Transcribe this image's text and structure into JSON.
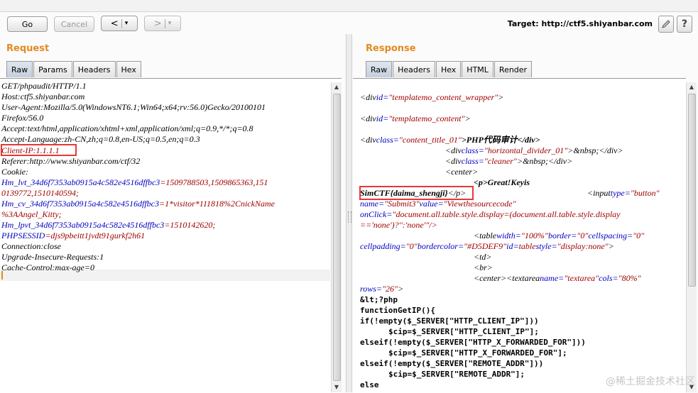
{
  "toolbar": {
    "go_label": "Go",
    "cancel_label": "Cancel",
    "back_label": "<",
    "back_menu": "▾",
    "forward_label": ">",
    "forward_menu": "▾",
    "target_text": "Target: http://ctf5.shiyanbar.com"
  },
  "request": {
    "title": "Request",
    "tabs": [
      "Raw",
      "Params",
      "Headers",
      "Hex"
    ],
    "lines": {
      "l1": "GET/phpaudit/HTTP/1.1",
      "l2": "Host:ctf5.shiyanbar.com",
      "l3": "User-Agent:Mozilla/5.0(WindowsNT6.1;Win64;x64;rv:56.0)Gecko/20100101",
      "l4": "Firefox/56.0",
      "l5": "Accept:text/html,application/xhtml+xml,application/xml;q=0.9,*/*;q=0.8",
      "l6": "Accept-Language:zh-CN,zh;q=0.8,en-US;q=0.5,en;q=0.3",
      "l7_name": "Client-IP",
      "l7_value": ":1.1.1.1",
      "l8": "Referer:http://www.shiyanbar.com/ctf/32",
      "l9": "Cookie:",
      "c1_name": "Hm_lvt_34d6f7353ab0915a4c582e4516dffbc3",
      "c1_value": "=1509788503,1509865363,151",
      "c1_cont": "0139772,1510140594;",
      "c2_name": "Hm_cv_34d6f7353ab0915a4c582e4516dffbc3",
      "c2_value": "=1*visitor*111818%2CnickName",
      "c2_cont": "%3AAngel_Kitty;",
      "c3_name": "Hm_lpvt_34d6f7353ab0915a4c582e4516dffbc3",
      "c3_value": "=1510142620;",
      "c4_name": "PHPSESSID",
      "c4_value": "=djs9pbeitt1jvdt91gurkf2h61",
      "l10": "Connection:close",
      "l11": "Upgrade-Insecure-Requests:1",
      "l12": "Cache-Control:max-age=0"
    }
  },
  "response": {
    "title": "Response",
    "tabs": [
      "Raw",
      "Headers",
      "Hex",
      "HTML",
      "Render"
    ],
    "lines": {
      "r1_a": "<div",
      "r1_b": "id=",
      "r1_c": "\"templatemo_content_wrapper\"",
      "r1_d": ">",
      "r2_a": "<div",
      "r2_b": "id=",
      "r2_c": "\"templatemo_content\"",
      "r2_d": ">",
      "r3_a": "<div",
      "r3_b": "class=",
      "r3_c": "\"content_title_01\"",
      "r3_d": ">PHP代码审计</div>",
      "r4_a": "<div",
      "r4_b": "class=",
      "r4_c": "\"horizontal_divider_01\"",
      "r4_d": ">&nbsp;</div>",
      "r5_a": "<div",
      "r5_b": "class=",
      "r5_c": "\"cleaner\"",
      "r5_d": ">&nbsp;</div>",
      "r6": "<center>",
      "r7": "<p>Great!Keyis",
      "r8_flag": "SimCTF{daima_shengji}",
      "r8_b": "</p>",
      "r8_c": "<input",
      "r8_d": "type=",
      "r8_e": "\"button\"",
      "r9_a": "name=",
      "r9_b": "\"Submit3\"",
      "r9_c": "value=",
      "r9_d": "\"Viewthesourcecode\"",
      "r10_a": "onClick=",
      "r10_b": "\"document.all.table.style.display=(document.all.table.style.display",
      "r11": "=='none')?'':'none'\"/>",
      "r12_a": "<table",
      "r12_b": "width=",
      "r12_c": "\"100%\"",
      "r12_d": "border=",
      "r12_e": "\"0\"",
      "r12_f": "cellspacing=",
      "r12_g": "\"0\"",
      "r13_a": "cellpadding=",
      "r13_b": "\"0\"",
      "r13_c": "bordercolor=",
      "r13_d": "\"#D5DEF9\"",
      "r13_e": "id=",
      "r13_f": "table",
      "r13_g": "style=",
      "r13_h": "\"display:none\"",
      "r13_i": ">",
      "r14": "<td>",
      "r15": "<br>",
      "r16_a": "<center><textarea",
      "r16_b": "name=",
      "r16_c": "\"textarea\"",
      "r16_d": "cols=",
      "r16_e": "\"80%\"",
      "r17_a": "rows=",
      "r17_b": "\"26\"",
      "r17_c": ">",
      "r18": "&lt;?php",
      "r19": "functionGetIP(){",
      "r20": "if(!empty($_SERVER[\"HTTP_CLIENT_IP\"]))",
      "r21": "$cip=$_SERVER[\"HTTP_CLIENT_IP\"];",
      "r22": "elseif(!empty($_SERVER[\"HTTP_X_FORWARDED_FOR\"]))",
      "r23": "$cip=$_SERVER[\"HTTP_X_FORWARDED_FOR\"];",
      "r24": "elseif(!empty($_SERVER[\"REMOTE_ADDR\"]))",
      "r25": "$cip=$_SERVER[\"REMOTE_ADDR\"];",
      "r26": "else"
    }
  },
  "watermark": "@稀土掘金技术社区"
}
